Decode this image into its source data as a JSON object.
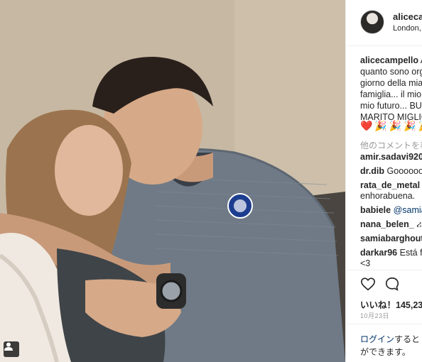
{
  "post": {
    "username": "alicecampello",
    "location": "London, United Kingdom",
    "caption_lines": [
      "A",
      "quanto sono org",
      "giorno della mia",
      "famiglia... il mio",
      "mio futuro... BU",
      "MARITO MIGLIO"
    ],
    "caption_emojis": "❤️🎉🎉🎉🎉",
    "more_comments": "他のコメントを表示",
    "comments": [
      {
        "user": "amir.sadavi920",
        "text": ""
      },
      {
        "user": "dr.dib",
        "text": "Gooooooo"
      },
      {
        "user": "rata_de_metal",
        "text": "C",
        "text2": "enhorabuena."
      },
      {
        "user": "babiele",
        "text": "@samia"
      },
      {
        "user": "nana_belen_",
        "text": "ሪ"
      },
      {
        "user": "samiabarghout",
        "text": ""
      },
      {
        "user": "darkar96",
        "text": "Está f",
        "text2": "<3"
      }
    ],
    "likes": "いいね！145,23",
    "date": "10月23日",
    "login_link": "ログイン",
    "login_suffix": "すると",
    "login_line2": "ができます。"
  },
  "colors": {
    "link": "#003569",
    "muted": "#999999",
    "heart_emoji": "#d21f3c"
  },
  "icons": {
    "heart": "heart-outline-icon",
    "comment": "comment-bubble-icon",
    "tag": "user-tag-icon"
  }
}
